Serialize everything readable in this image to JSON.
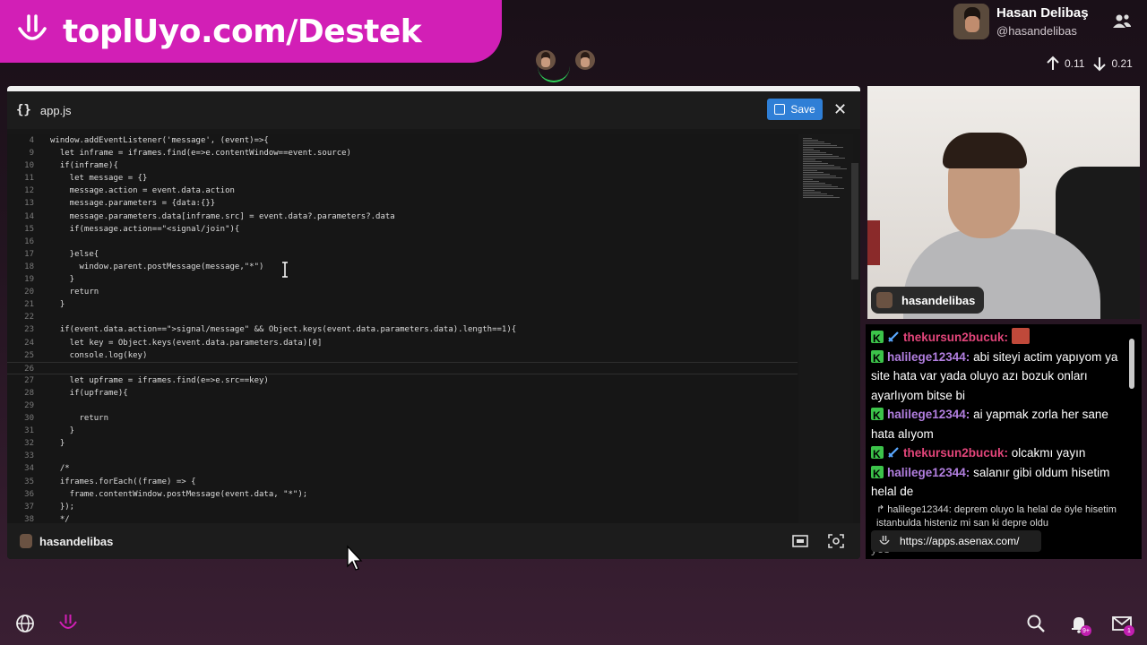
{
  "banner": {
    "text": "toplUyo.com/Destek",
    "icon": "smile-logo-icon"
  },
  "profile": {
    "name": "Hasan Delibaş",
    "handle": "@hasandelibas"
  },
  "network": {
    "up": "0.11",
    "down": "0.21"
  },
  "editor": {
    "filename": "app.js",
    "save_label": "Save",
    "close_label": "✕",
    "footer_user": "hasandelibas",
    "lines": [
      {
        "n": "4",
        "t": "window.addEventListener('message', (event)=>{"
      },
      {
        "n": "9",
        "t": "  let inframe = iframes.find(e=>e.contentWindow==event.source)"
      },
      {
        "n": "10",
        "t": "  if(inframe){"
      },
      {
        "n": "11",
        "t": "    let message = {}"
      },
      {
        "n": "12",
        "t": "    message.action = event.data.action"
      },
      {
        "n": "13",
        "t": "    message.parameters = {data:{}}"
      },
      {
        "n": "14",
        "t": "    message.parameters.data[inframe.src] = event.data?.parameters?.data"
      },
      {
        "n": "15",
        "t": "    if(message.action==\"<signal/join\"){"
      },
      {
        "n": "16",
        "t": ""
      },
      {
        "n": "17",
        "t": "    }else{"
      },
      {
        "n": "18",
        "t": "      window.parent.postMessage(message,\"*\")"
      },
      {
        "n": "19",
        "t": "    }"
      },
      {
        "n": "20",
        "t": "    return"
      },
      {
        "n": "21",
        "t": "  }"
      },
      {
        "n": "22",
        "t": ""
      },
      {
        "n": "23",
        "t": "  if(event.data.action==\">signal/message\" && Object.keys(event.data.parameters.data).length==1){"
      },
      {
        "n": "24",
        "t": "    let key = Object.keys(event.data.parameters.data)[0]"
      },
      {
        "n": "25",
        "t": "    console.log(key)"
      },
      {
        "n": "26",
        "t": ""
      },
      {
        "n": "27",
        "t": "    let upframe = iframes.find(e=>e.src==key)"
      },
      {
        "n": "28",
        "t": "    if(upframe){"
      },
      {
        "n": "29",
        "t": ""
      },
      {
        "n": "30",
        "t": "      return"
      },
      {
        "n": "31",
        "t": "    }"
      },
      {
        "n": "32",
        "t": "  }"
      },
      {
        "n": "33",
        "t": ""
      },
      {
        "n": "34",
        "t": "  /*"
      },
      {
        "n": "35",
        "t": "  iframes.forEach((frame) => {"
      },
      {
        "n": "36",
        "t": "    frame.contentWindow.postMessage(event.data, \"*\");"
      },
      {
        "n": "37",
        "t": "  });"
      },
      {
        "n": "38",
        "t": "  */"
      }
    ]
  },
  "video": {
    "label": "hasandelibas"
  },
  "chat": {
    "messages": [
      {
        "user": "thekursun2bucuk:",
        "text": "",
        "style": "a",
        "sword": true,
        "emote": true
      },
      {
        "user": "halilege12344:",
        "text": "abi siteyi actim yapıyom ya site hata var yada oluyo azı bozuk onları ayarlıyom bitse bi",
        "style": "b",
        "sword": false,
        "emote": false
      },
      {
        "user": "halilege12344:",
        "text": "ai yapmak zorla her sane hata alıyom",
        "style": "b",
        "sword": false,
        "emote": false
      },
      {
        "user": "thekursun2bucuk:",
        "text": "olcakmı yayın",
        "style": "a",
        "sword": true,
        "emote": false
      },
      {
        "user": "halilege12344:",
        "text": "salanır gibi oldum hisetim helal de",
        "style": "b",
        "sword": false,
        "emote": false
      }
    ],
    "reply": "↱ halilege12344: deprem oluyo la helal de öyle hisetim istanbulda histeniz mi san ki depre oldu",
    "url": "https://apps.asenax.com/",
    "cut_tail": "yes"
  },
  "bottom": {
    "notif_badge": "9+",
    "mail_badge": "1"
  }
}
